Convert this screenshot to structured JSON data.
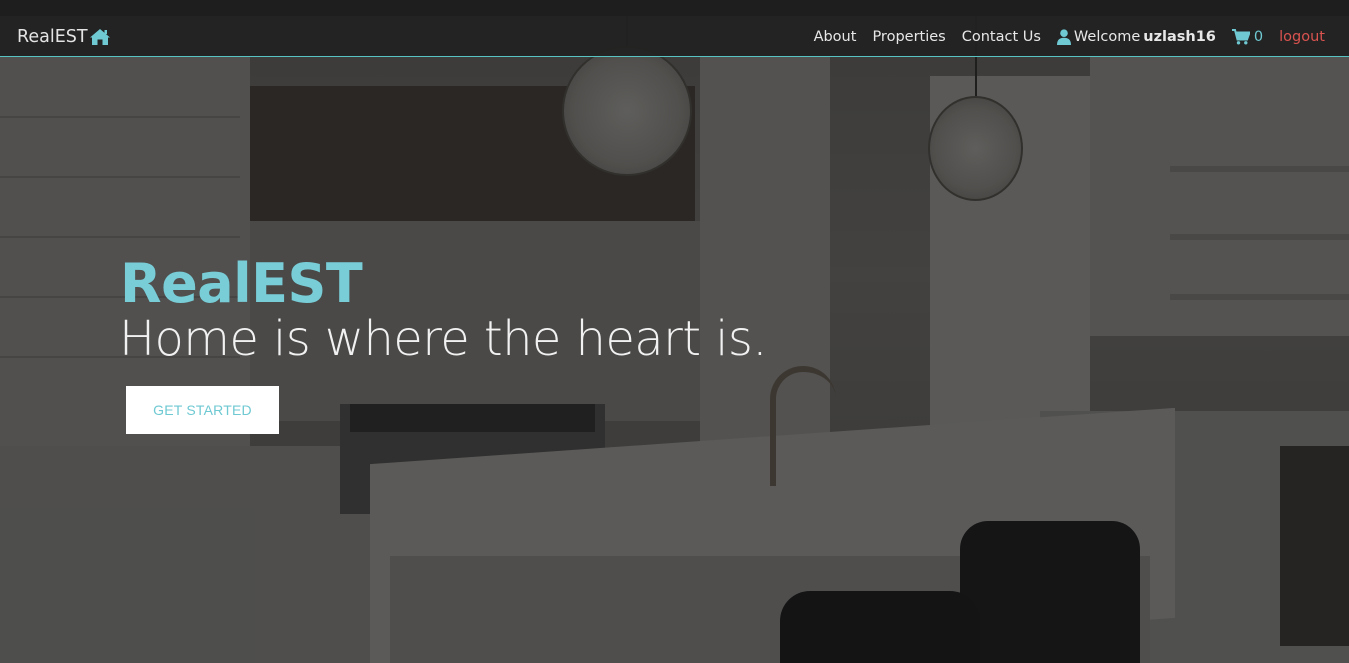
{
  "brand": {
    "name": "RealEST",
    "icon": "home-icon"
  },
  "nav": {
    "about": "About",
    "properties": "Properties",
    "contact": "Contact Us",
    "welcome_prefix": "Welcome",
    "username": "uzlash16",
    "user_icon": "user-icon",
    "cart_icon": "shopping-cart-icon",
    "cart_count": "0",
    "logout": "logout"
  },
  "hero": {
    "title": "RealEST",
    "subtitle": "Home is where the heart is.",
    "cta_label": "GET STARTED"
  },
  "colors": {
    "accent": "#6fc9d3",
    "logout": "#d9534f",
    "navbar_bg": "#222222"
  }
}
